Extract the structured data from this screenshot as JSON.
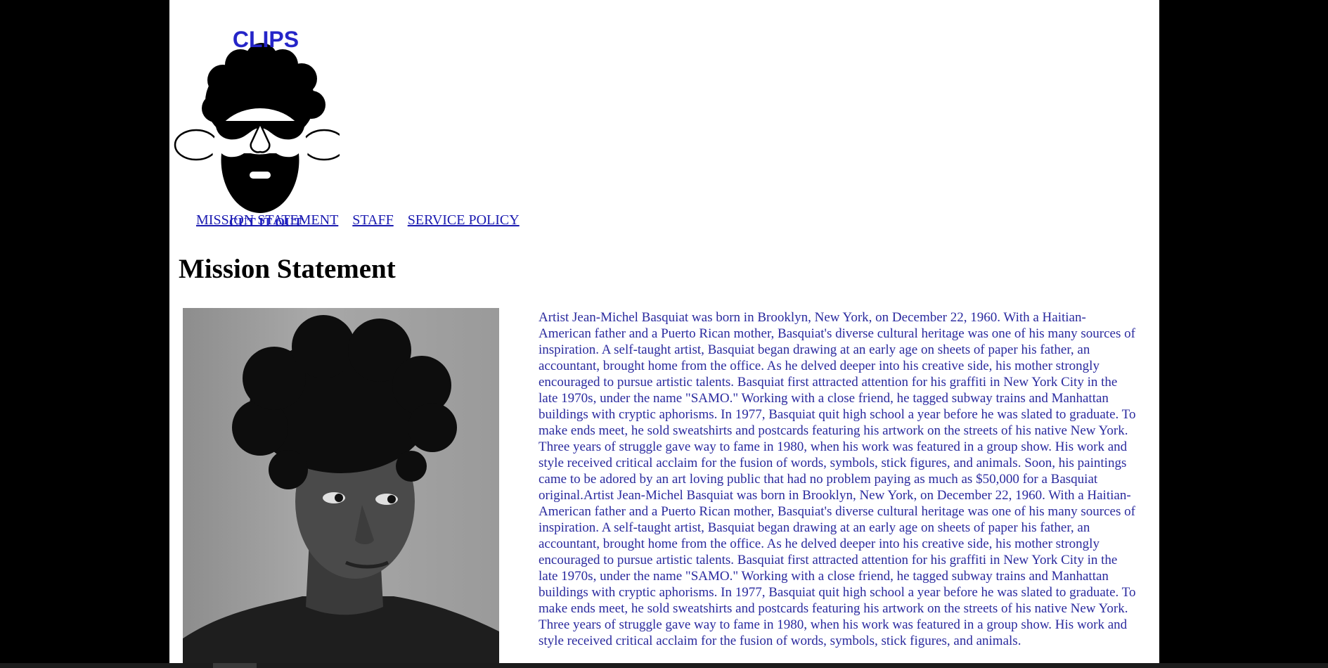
{
  "logo": {
    "top_text": "CLIPS",
    "bottom_text": "CUT IT OUT",
    "icon": "bearded-face-logo"
  },
  "nav": {
    "items": [
      {
        "label": "MISSION STATEMENT"
      },
      {
        "label": "STAFF"
      },
      {
        "label": "SERVICE POLICY"
      }
    ]
  },
  "main": {
    "title": "Mission Statement",
    "photo": "portrait-photo",
    "body": "Artist Jean-Michel Basquiat was born in Brooklyn, New York, on December 22, 1960. With a Haitian-American father and a Puerto Rican mother, Basquiat's diverse cultural heritage was one of his many sources of inspiration. A self-taught artist, Basquiat began drawing at an early age on sheets of paper his father, an accountant, brought home from the office. As he delved deeper into his creative side, his mother strongly encouraged to pursue artistic talents. Basquiat first attracted attention for his graffiti in New York City in the late 1970s, under the name \"SAMO.\" Working with a close friend, he tagged subway trains and Manhattan buildings with cryptic aphorisms. In 1977, Basquiat quit high school a year before he was slated to graduate. To make ends meet, he sold sweatshirts and postcards featuring his artwork on the streets of his native New York. Three years of struggle gave way to fame in 1980, when his work was featured in a group show. His work and style received critical acclaim for the fusion of words, symbols, stick figures, and animals. Soon, his paintings came to be adored by an art loving public that had no problem paying as much as $50,000 for a Basquiat original.Artist Jean-Michel Basquiat was born in Brooklyn, New York, on December 22, 1960. With a Haitian-American father and a Puerto Rican mother, Basquiat's diverse cultural heritage was one of his many sources of inspiration. A self-taught artist, Basquiat began drawing at an early age on sheets of paper his father, an accountant, brought home from the office. As he delved deeper into his creative side, his mother strongly encouraged to pursue artistic talents. Basquiat first attracted attention for his graffiti in New York City in the late 1970s, under the name \"SAMO.\" Working with a close friend, he tagged subway trains and Manhattan buildings with cryptic aphorisms. In 1977, Basquiat quit high school a year before he was slated to graduate. To make ends meet, he sold sweatshirts and postcards featuring his artwork on the streets of his native New York. Three years of struggle gave way to fame in 1980, when his work was featured in a group show. His work and style received critical acclaim for the fusion of words, symbols, stick figures, and animals."
  },
  "colors": {
    "page_background": "#000000",
    "content_background": "#ffffff",
    "link": "#1a1ab0",
    "body_text": "#2a2a9e",
    "logo_text": "#2525c8"
  }
}
